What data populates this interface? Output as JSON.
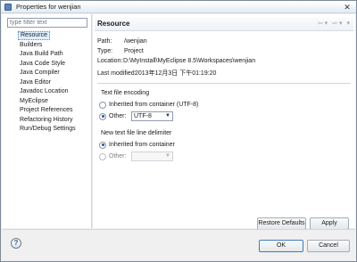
{
  "window": {
    "title": "Properties for wenjian",
    "close_glyph": "✕"
  },
  "left": {
    "filter_placeholder": "type filter text",
    "items": [
      {
        "label": "Resource",
        "selected": true
      },
      {
        "label": "Builders"
      },
      {
        "label": "Java Build Path"
      },
      {
        "label": "Java Code Style"
      },
      {
        "label": "Java Compiler"
      },
      {
        "label": "Java Editor"
      },
      {
        "label": "Javadoc Location"
      },
      {
        "label": "MyEclipse"
      },
      {
        "label": "Project References"
      },
      {
        "label": "Refactoring History"
      },
      {
        "label": "Run/Debug Settings"
      }
    ]
  },
  "page": {
    "title": "Resource",
    "nav_back_icon": "back-arrow-icon",
    "nav_forward_icon": "forward-arrow-icon",
    "path_label": "Path:",
    "path_value": "/wenjian",
    "type_label": "Type:",
    "type_value": "Project",
    "location_label": "Location:",
    "location_value": "D:\\MyInstall\\MyEclipse 8.5\\Workspaces\\wenjian",
    "last_modified_label": "Last modified:",
    "last_modified_value": "2013年12月3日 下午01:19:20"
  },
  "encoding": {
    "title": "Text file encoding",
    "inherited_label": "Inherited from container (UTF-8)",
    "other_label": "Other:",
    "other_value": "UTF-8",
    "selected": "other"
  },
  "delimiter": {
    "title": "New text file line delimiter",
    "inherited_label": "Inherited from container",
    "other_label": "Other:",
    "other_value": "",
    "selected": "inherited"
  },
  "buttons": {
    "restore_defaults": "Restore Defaults",
    "apply": "Apply",
    "ok": "OK",
    "cancel": "Cancel",
    "help_glyph": "?"
  }
}
